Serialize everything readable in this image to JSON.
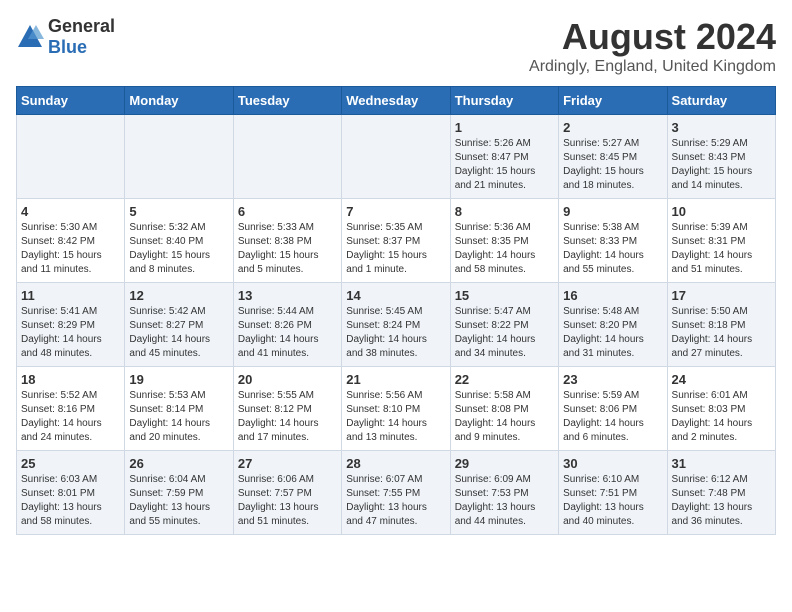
{
  "logo": {
    "general": "General",
    "blue": "Blue"
  },
  "title": "August 2024",
  "subtitle": "Ardingly, England, United Kingdom",
  "weekdays": [
    "Sunday",
    "Monday",
    "Tuesday",
    "Wednesday",
    "Thursday",
    "Friday",
    "Saturday"
  ],
  "weeks": [
    [
      {
        "day": "",
        "sunrise": "",
        "sunset": "",
        "daylight": ""
      },
      {
        "day": "",
        "sunrise": "",
        "sunset": "",
        "daylight": ""
      },
      {
        "day": "",
        "sunrise": "",
        "sunset": "",
        "daylight": ""
      },
      {
        "day": "",
        "sunrise": "",
        "sunset": "",
        "daylight": ""
      },
      {
        "day": "1",
        "sunrise": "Sunrise: 5:26 AM",
        "sunset": "Sunset: 8:47 PM",
        "daylight": "Daylight: 15 hours and 21 minutes."
      },
      {
        "day": "2",
        "sunrise": "Sunrise: 5:27 AM",
        "sunset": "Sunset: 8:45 PM",
        "daylight": "Daylight: 15 hours and 18 minutes."
      },
      {
        "day": "3",
        "sunrise": "Sunrise: 5:29 AM",
        "sunset": "Sunset: 8:43 PM",
        "daylight": "Daylight: 15 hours and 14 minutes."
      }
    ],
    [
      {
        "day": "4",
        "sunrise": "Sunrise: 5:30 AM",
        "sunset": "Sunset: 8:42 PM",
        "daylight": "Daylight: 15 hours and 11 minutes."
      },
      {
        "day": "5",
        "sunrise": "Sunrise: 5:32 AM",
        "sunset": "Sunset: 8:40 PM",
        "daylight": "Daylight: 15 hours and 8 minutes."
      },
      {
        "day": "6",
        "sunrise": "Sunrise: 5:33 AM",
        "sunset": "Sunset: 8:38 PM",
        "daylight": "Daylight: 15 hours and 5 minutes."
      },
      {
        "day": "7",
        "sunrise": "Sunrise: 5:35 AM",
        "sunset": "Sunset: 8:37 PM",
        "daylight": "Daylight: 15 hours and 1 minute."
      },
      {
        "day": "8",
        "sunrise": "Sunrise: 5:36 AM",
        "sunset": "Sunset: 8:35 PM",
        "daylight": "Daylight: 14 hours and 58 minutes."
      },
      {
        "day": "9",
        "sunrise": "Sunrise: 5:38 AM",
        "sunset": "Sunset: 8:33 PM",
        "daylight": "Daylight: 14 hours and 55 minutes."
      },
      {
        "day": "10",
        "sunrise": "Sunrise: 5:39 AM",
        "sunset": "Sunset: 8:31 PM",
        "daylight": "Daylight: 14 hours and 51 minutes."
      }
    ],
    [
      {
        "day": "11",
        "sunrise": "Sunrise: 5:41 AM",
        "sunset": "Sunset: 8:29 PM",
        "daylight": "Daylight: 14 hours and 48 minutes."
      },
      {
        "day": "12",
        "sunrise": "Sunrise: 5:42 AM",
        "sunset": "Sunset: 8:27 PM",
        "daylight": "Daylight: 14 hours and 45 minutes."
      },
      {
        "day": "13",
        "sunrise": "Sunrise: 5:44 AM",
        "sunset": "Sunset: 8:26 PM",
        "daylight": "Daylight: 14 hours and 41 minutes."
      },
      {
        "day": "14",
        "sunrise": "Sunrise: 5:45 AM",
        "sunset": "Sunset: 8:24 PM",
        "daylight": "Daylight: 14 hours and 38 minutes."
      },
      {
        "day": "15",
        "sunrise": "Sunrise: 5:47 AM",
        "sunset": "Sunset: 8:22 PM",
        "daylight": "Daylight: 14 hours and 34 minutes."
      },
      {
        "day": "16",
        "sunrise": "Sunrise: 5:48 AM",
        "sunset": "Sunset: 8:20 PM",
        "daylight": "Daylight: 14 hours and 31 minutes."
      },
      {
        "day": "17",
        "sunrise": "Sunrise: 5:50 AM",
        "sunset": "Sunset: 8:18 PM",
        "daylight": "Daylight: 14 hours and 27 minutes."
      }
    ],
    [
      {
        "day": "18",
        "sunrise": "Sunrise: 5:52 AM",
        "sunset": "Sunset: 8:16 PM",
        "daylight": "Daylight: 14 hours and 24 minutes."
      },
      {
        "day": "19",
        "sunrise": "Sunrise: 5:53 AM",
        "sunset": "Sunset: 8:14 PM",
        "daylight": "Daylight: 14 hours and 20 minutes."
      },
      {
        "day": "20",
        "sunrise": "Sunrise: 5:55 AM",
        "sunset": "Sunset: 8:12 PM",
        "daylight": "Daylight: 14 hours and 17 minutes."
      },
      {
        "day": "21",
        "sunrise": "Sunrise: 5:56 AM",
        "sunset": "Sunset: 8:10 PM",
        "daylight": "Daylight: 14 hours and 13 minutes."
      },
      {
        "day": "22",
        "sunrise": "Sunrise: 5:58 AM",
        "sunset": "Sunset: 8:08 PM",
        "daylight": "Daylight: 14 hours and 9 minutes."
      },
      {
        "day": "23",
        "sunrise": "Sunrise: 5:59 AM",
        "sunset": "Sunset: 8:06 PM",
        "daylight": "Daylight: 14 hours and 6 minutes."
      },
      {
        "day": "24",
        "sunrise": "Sunrise: 6:01 AM",
        "sunset": "Sunset: 8:03 PM",
        "daylight": "Daylight: 14 hours and 2 minutes."
      }
    ],
    [
      {
        "day": "25",
        "sunrise": "Sunrise: 6:03 AM",
        "sunset": "Sunset: 8:01 PM",
        "daylight": "Daylight: 13 hours and 58 minutes."
      },
      {
        "day": "26",
        "sunrise": "Sunrise: 6:04 AM",
        "sunset": "Sunset: 7:59 PM",
        "daylight": "Daylight: 13 hours and 55 minutes."
      },
      {
        "day": "27",
        "sunrise": "Sunrise: 6:06 AM",
        "sunset": "Sunset: 7:57 PM",
        "daylight": "Daylight: 13 hours and 51 minutes."
      },
      {
        "day": "28",
        "sunrise": "Sunrise: 6:07 AM",
        "sunset": "Sunset: 7:55 PM",
        "daylight": "Daylight: 13 hours and 47 minutes."
      },
      {
        "day": "29",
        "sunrise": "Sunrise: 6:09 AM",
        "sunset": "Sunset: 7:53 PM",
        "daylight": "Daylight: 13 hours and 44 minutes."
      },
      {
        "day": "30",
        "sunrise": "Sunrise: 6:10 AM",
        "sunset": "Sunset: 7:51 PM",
        "daylight": "Daylight: 13 hours and 40 minutes."
      },
      {
        "day": "31",
        "sunrise": "Sunrise: 6:12 AM",
        "sunset": "Sunset: 7:48 PM",
        "daylight": "Daylight: 13 hours and 36 minutes."
      }
    ]
  ]
}
